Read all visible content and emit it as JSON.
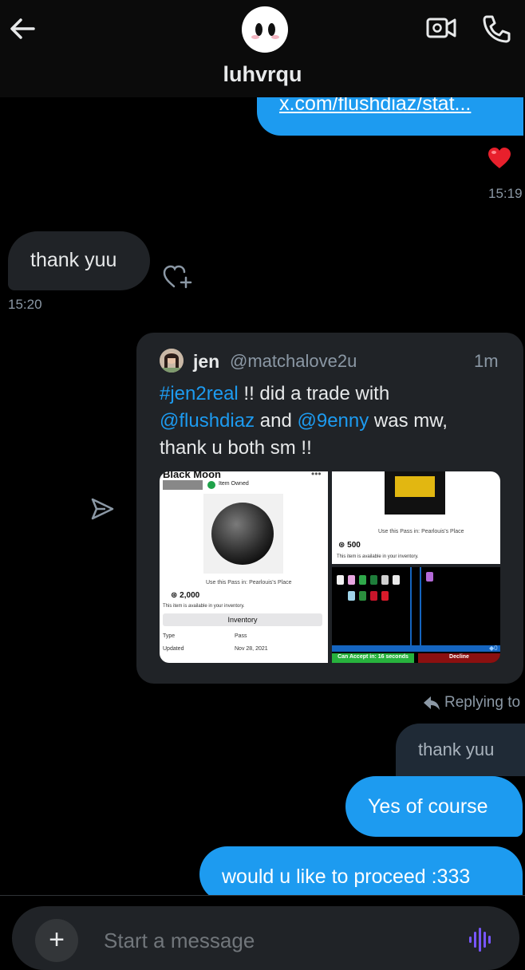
{
  "colors": {
    "accent": "#1d9bf0",
    "background": "#000000",
    "bubble_in": "#202327"
  },
  "header": {
    "username": "luhvrqu",
    "icons": [
      "back-arrow-icon",
      "video-call-icon",
      "phone-call-icon"
    ]
  },
  "messages": {
    "link_text": "x.com/flushdiaz/stat...",
    "reaction_emoji": "❤️",
    "time_1": "15:19",
    "incoming_text": "thank yuu",
    "time_2": "15:20"
  },
  "tweet": {
    "name": "jen",
    "handle": "@matchalove2u",
    "time": "1m",
    "line1_tag": "#jen2real",
    "line1_rest": " !! did a trade with",
    "line2_mention": "@flushdiaz",
    "line2_and": " and ",
    "line2_mention2": "@9enny",
    "line2_rest": " was mw,",
    "line3": "thank u both sm !!",
    "image1": {
      "title": "Black Moon",
      "owned": "Item Owned",
      "use_pass": "Use this Pass in: Pearlouis's Place",
      "price": "2,000",
      "available": "This item is available in your inventory.",
      "inventory_button": "Inventory",
      "type_label": "Type",
      "type_value": "Pass",
      "updated_label": "Updated",
      "updated_value": "Nov 28, 2021"
    },
    "image2": {
      "use_pass": "Use this Pass in: Pearlouis's Place",
      "price": "500",
      "available": "This item is available in your inventory."
    },
    "image3": {
      "accept": "Can Accept in: 16 seconds",
      "decline": "Decline",
      "count": "0"
    }
  },
  "reply": {
    "replying_label": "Replying to",
    "quoted_text": "thank yuu",
    "reply_1": "Yes of course",
    "reply_2": "would u like to proceed :333"
  },
  "composer": {
    "plus_label": "+",
    "placeholder": "Start a message"
  }
}
